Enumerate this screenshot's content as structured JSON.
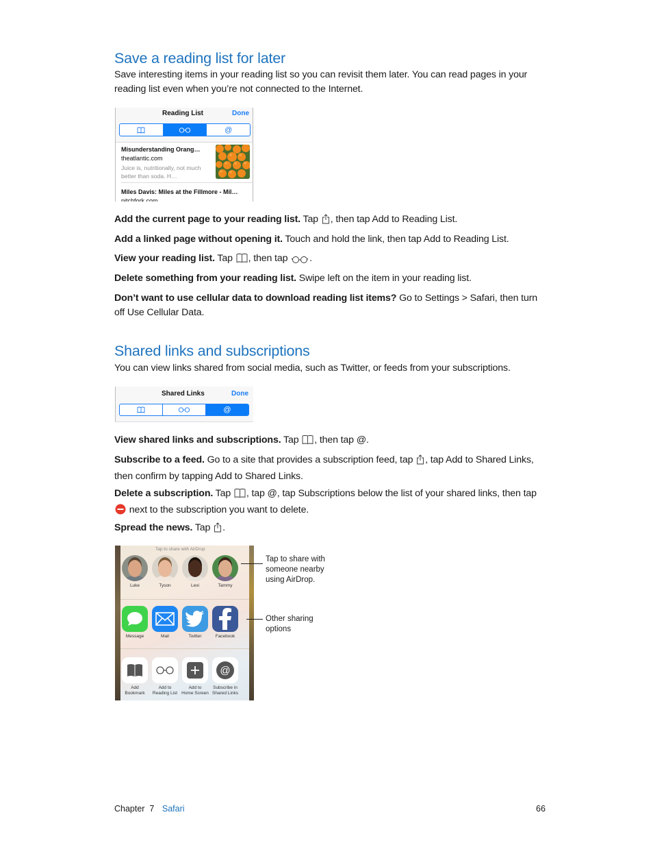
{
  "section1": {
    "heading": "Save a reading list for later",
    "intro": "Save interesting items in your reading list so you can revisit them later. You can read pages in your reading list even when you’re not connected to the Internet.",
    "screenshot": {
      "nav_title": "Reading List",
      "done_label": "Done",
      "segments": [
        {
          "icon": "book-icon",
          "glyph": "📖",
          "active": false
        },
        {
          "icon": "glasses-icon",
          "glyph": "○○",
          "active": true
        },
        {
          "icon": "at-icon",
          "glyph": "@",
          "active": false
        }
      ],
      "items": [
        {
          "title": "Misunderstanding Orang…",
          "site": "theatlantic.com",
          "description": "Juice is, nutritionally, not much better than soda. H…",
          "thumbnail": "oranges-thumbnail"
        },
        {
          "title": "Miles Davis: Miles at the Fillmore - Mil…",
          "site": "pitchfork.com"
        }
      ]
    },
    "tips": [
      {
        "bold": "Add the current page to your reading list.",
        "parts": [
          " Tap ",
          "{share}",
          ", then tap Add to Reading List."
        ]
      },
      {
        "bold": "Add a linked page without opening it.",
        "parts": [
          " Touch and hold the link, then tap Add to Reading List."
        ]
      },
      {
        "bold": "View your reading list.",
        "parts": [
          " Tap ",
          "{book}",
          ", then tap ",
          "{glasses}",
          "."
        ]
      },
      {
        "bold": "Delete something from your reading list.",
        "parts": [
          " Swipe left on the item in your reading list."
        ]
      },
      {
        "bold": "Don’t want to use cellular data to download reading list items?",
        "parts": [
          " Go to Settings > Safari, then turn off Use Cellular Data."
        ]
      }
    ]
  },
  "section2": {
    "heading": "Shared links and subscriptions",
    "intro": "You can view links shared from social media, such as Twitter, or feeds from your subscriptions.",
    "screenshot": {
      "nav_title": "Shared Links",
      "done_label": "Done",
      "segments": [
        {
          "icon": "book-icon",
          "active": false
        },
        {
          "icon": "glasses-icon",
          "active": false
        },
        {
          "icon": "at-icon",
          "glyph": "@",
          "active": true
        }
      ]
    },
    "tips": [
      {
        "bold": "View shared links and subscriptions.",
        "parts": [
          " Tap ",
          "{book}",
          ", then tap @."
        ]
      },
      {
        "bold": "Subscribe to a feed.",
        "parts": [
          " Go to a site that provides a subscription feed, tap ",
          "{share}",
          ", tap Add to Shared Links, then confirm by tapping Add to Shared Links."
        ]
      },
      {
        "bold": "Delete a subscription.",
        "parts": [
          " Tap ",
          "{book}",
          ", tap @, tap Subscriptions below the list of your shared links, then tap ",
          "{minus}",
          " next to the subscription you want to delete."
        ]
      },
      {
        "bold": "Spread the news.",
        "parts": [
          " Tap ",
          "{share}",
          "."
        ]
      }
    ]
  },
  "share_sheet": {
    "airdrop_label": "Tap to share with AirDrop",
    "people": [
      {
        "name": "Luke",
        "skin": "#d9a584",
        "hair": "#5a4534",
        "shirt": "#6f7a80",
        "bg": "#8a8f86"
      },
      {
        "name": "Tyson",
        "skin": "#e7b99a",
        "hair": "#7a5a3a",
        "shirt": "#f0e6dc",
        "bg": "#d8d2c8"
      },
      {
        "name": "Lexi",
        "skin": "#4a2c1e",
        "hair": "#1a120c",
        "shirt": "#e7e2da",
        "bg": "#d9d4cc"
      },
      {
        "name": "Tammy",
        "skin": "#dcae8e",
        "hair": "#3a2418",
        "shirt": "#7d6a8a",
        "bg": "#4d8a4a"
      }
    ],
    "apps": [
      {
        "label": "Message",
        "icon": "message-icon",
        "color": "#3fd34b"
      },
      {
        "label": "Mail",
        "icon": "mail-icon",
        "color": "#1e86f2"
      },
      {
        "label": "Twitter",
        "icon": "twitter-icon",
        "color": "#3d9be3"
      },
      {
        "label": "Facebook",
        "icon": "facebook-icon",
        "color": "#3b5998"
      }
    ],
    "actions": [
      {
        "label_line1": "Add",
        "label_line2": "Bookmark",
        "icon": "bookmark-icon"
      },
      {
        "label_line1": "Add to",
        "label_line2": "Reading List",
        "icon": "glasses-icon"
      },
      {
        "label_line1": "Add to",
        "label_line2": "Home Screen",
        "icon": "plus-icon"
      },
      {
        "label_line1": "Subscribe in",
        "label_line2": "Shared Links",
        "icon": "at-icon"
      }
    ],
    "callouts": [
      {
        "text": "Tap to share with someone nearby using AirDrop."
      },
      {
        "text": "Other sharing options"
      }
    ]
  },
  "footer": {
    "chapter_label": "Chapter  7",
    "chapter_name": "Safari",
    "page_number": "66"
  },
  "colors": {
    "heading": "#1e73be",
    "ios_blue": "#0a7cf7",
    "delete_red": "#e5392b"
  }
}
